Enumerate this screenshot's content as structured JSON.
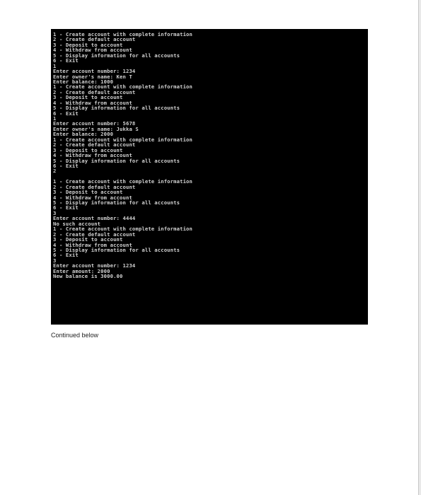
{
  "console": {
    "lines": [
      "1 - Create account with complete information",
      "2 - Create default account",
      "3 - Deposit to account",
      "4 - Withdraw from account",
      "5 - Display information for all accounts",
      "6 - Exit",
      "1",
      "Enter account number: 1234",
      "Enter owner's name: Ken T",
      "Enter balance: 1000",
      "1 - Create account with complete information",
      "2 - Create default account",
      "3 - Deposit to account",
      "4 - Withdraw from account",
      "5 - Display information for all accounts",
      "6 - Exit",
      "1",
      "Enter account number: 5678",
      "Enter owner's name: Jukka S",
      "Enter balance: 2000",
      "1 - Create account with complete information",
      "2 - Create default account",
      "3 - Deposit to account",
      "4 - Withdraw from account",
      "5 - Display information for all accounts",
      "6 - Exit",
      "2",
      "",
      "1 - Create account with complete information",
      "2 - Create default account",
      "3 - Deposit to account",
      "4 - Withdraw from account",
      "5 - Display information for all accounts",
      "6 - Exit",
      "3",
      "Enter account number: 4444",
      "No such account",
      "1 - Create account with complete information",
      "2 - Create default account",
      "3 - Deposit to account",
      "4 - Withdraw from account",
      "5 - Display information for all accounts",
      "6 - Exit",
      "3",
      "Enter account number: 1234",
      "Enter amount: 2000",
      "New balance is 3000.00"
    ]
  },
  "caption": "Continued below"
}
